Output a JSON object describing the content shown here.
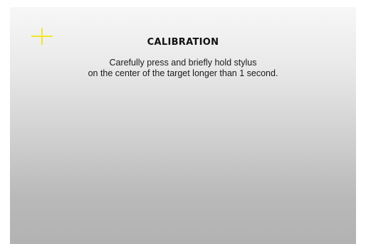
{
  "screen": {
    "title": "CALIBRATION",
    "instruction_line1": "Carefully press and briefly hold stylus",
    "instruction_line2": "on the center of the target longer than 1 second.",
    "target_icon": "crosshair-target-icon",
    "colors": {
      "target": "#f2e62a",
      "background_top": "#f7f7f7",
      "background_bottom": "#b2b2b2",
      "text": "#111111"
    }
  }
}
